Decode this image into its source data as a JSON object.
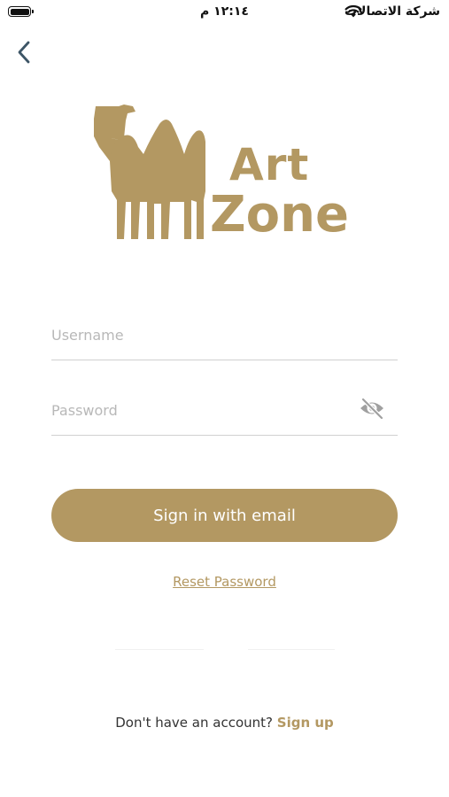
{
  "status_bar": {
    "time": "١٢:١٤ م",
    "carrier": "شركة الاتصالات"
  },
  "logo": {
    "line1": "Art",
    "line2": "Zone"
  },
  "form": {
    "username_placeholder": "Username",
    "username_value": "",
    "password_placeholder": "Password",
    "password_value": "",
    "signin_label": "Sign in with email",
    "reset_label": "Reset Password"
  },
  "footer": {
    "prompt": "Don't have an account?",
    "signup_label": "Sign up"
  },
  "colors": {
    "accent": "#b39862",
    "placeholder": "#b8b8b8",
    "underline": "#d0d0d0"
  },
  "icons": {
    "back": "chevron-left-icon",
    "password_toggle": "eye-slash-icon",
    "wifi": "wifi-icon",
    "battery": "battery-icon"
  }
}
